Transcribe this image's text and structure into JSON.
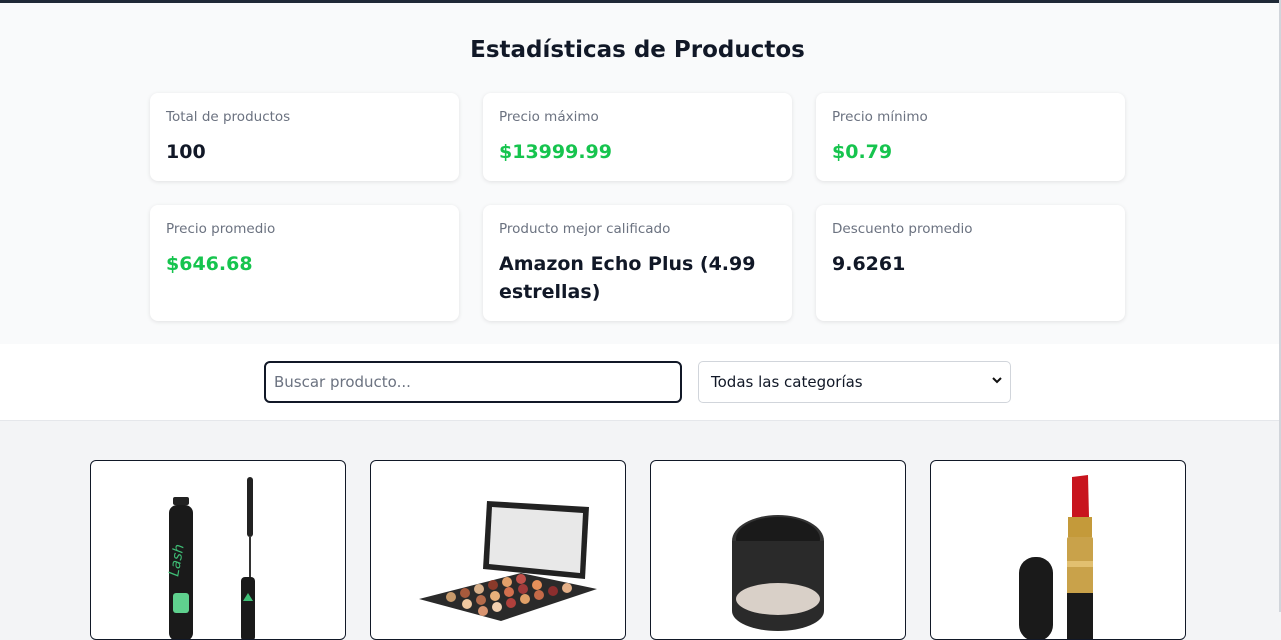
{
  "stats": {
    "title": "Estadísticas de Productos",
    "cards": [
      {
        "label": "Total de productos",
        "value": "100"
      },
      {
        "label": "Precio máximo",
        "value": "$13999.99"
      },
      {
        "label": "Precio mínimo",
        "value": "$0.79"
      },
      {
        "label": "Precio promedio",
        "value": "$646.68"
      },
      {
        "label": "Producto mejor calificado",
        "value": "Amazon Echo Plus (4.99 estrellas)"
      },
      {
        "label": "Descuento promedio",
        "value": "9.6261"
      }
    ]
  },
  "filters": {
    "search_placeholder": "Buscar producto...",
    "category_selected": "Todas las categorías"
  },
  "products": [
    {
      "image": "mascara-image"
    },
    {
      "image": "eyeshadow-palette-image"
    },
    {
      "image": "powder-compact-image"
    },
    {
      "image": "lipstick-image"
    }
  ],
  "colors": {
    "price_green": "#16c44e",
    "text_dark": "#111827",
    "label_gray": "#6b7280"
  }
}
